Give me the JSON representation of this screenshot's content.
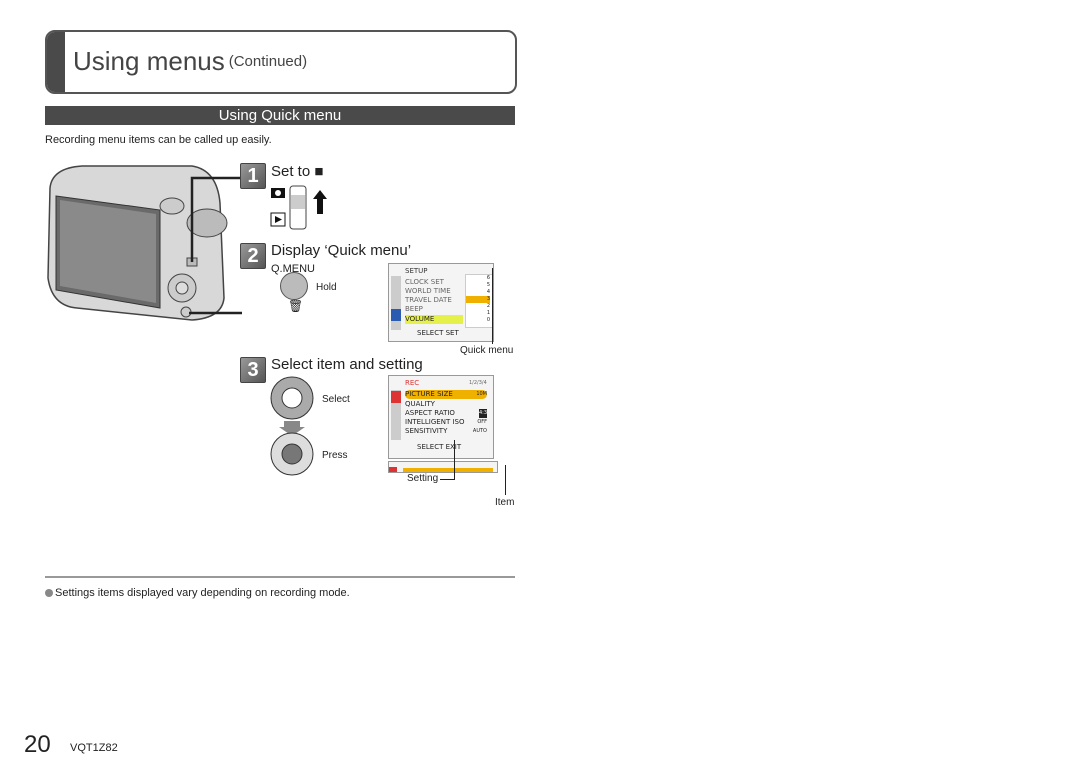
{
  "header": {
    "title": "Using menus",
    "subtitle": "(Continued)"
  },
  "section": {
    "title": "Using Quick menu",
    "intro": "Recording menu items can be called up easily."
  },
  "steps": [
    {
      "number": "1",
      "title": "Set to",
      "icon": "camera-icon"
    },
    {
      "number": "2",
      "title": "Display ‘Quick menu’",
      "button_label": "Q.MENU",
      "action": "Hold",
      "callout": "Quick menu"
    },
    {
      "number": "3",
      "title": "Select item and setting",
      "select_label": "Select",
      "press_label": "Press",
      "setting_label": "Setting",
      "item_label": "Item"
    }
  ],
  "setup_screen": {
    "header": "SETUP",
    "items": [
      "CLOCK SET",
      "WORLD TIME",
      "TRAVEL DATE",
      "BEEP",
      "VOLUME"
    ],
    "levels": [
      "6",
      "5",
      "4",
      "3",
      "2",
      "1",
      "0"
    ],
    "footer": "SELECT SET"
  },
  "rec_screen": {
    "header": "REC",
    "page": "1/2/3/4",
    "items": [
      {
        "label": "PICTURE SIZE",
        "value": "10M"
      },
      {
        "label": "QUALITY",
        "value": ""
      },
      {
        "label": "ASPECT RATIO",
        "value": "4:3"
      },
      {
        "label": "INTELLIGENT ISO",
        "value": "OFF"
      },
      {
        "label": "SENSITIVITY",
        "value": "AUTO"
      }
    ],
    "footer": "SELECT EXIT"
  },
  "footer": {
    "note": "Settings items displayed vary depending on recording mode.",
    "page_number": "20",
    "code": "VQT1Z82"
  }
}
